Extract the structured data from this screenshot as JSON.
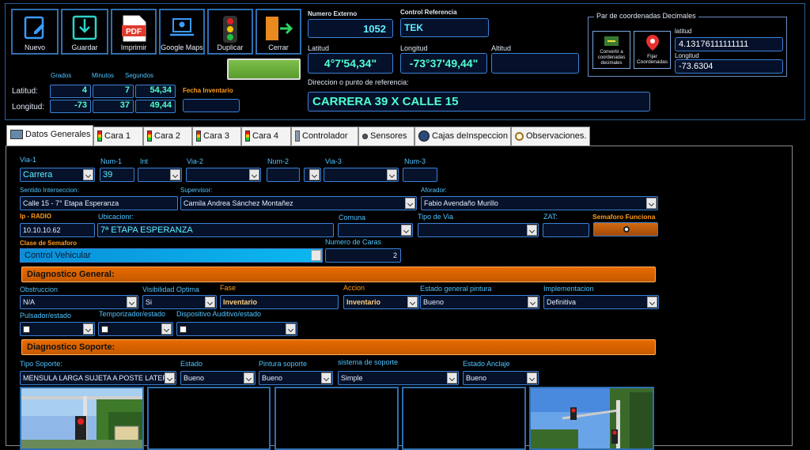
{
  "toolbar": {
    "nuevo": "Nuevo",
    "guardar": "Guardar",
    "imprimir": "Imprimir",
    "google_maps": "Google Maps",
    "duplicar": "Duplicar",
    "cerrar": "Cerrar"
  },
  "header": {
    "numero_externo_label": "Numero Externo",
    "numero_externo": "1052",
    "control_ref_label": "Control Referencia",
    "control_ref": "TEK",
    "latitud_label": "Latitud",
    "latitud": "4°7'54,34\"",
    "longitud_label": "Longitud",
    "longitud": "-73°37'49,44\"",
    "altitud_label": "Altitud",
    "altitud": "",
    "direccion_label": "Direccion o punto de referencia:",
    "direccion": "CARRERA 39 X CALLE 15"
  },
  "coords": {
    "title": "Par de coordenadas Decimales",
    "convert_label": "Convertir a coordenadas decimales",
    "fijar_label": "Fijar Coordenadas",
    "lat_label": "latitud",
    "lat": "4.13176111111111",
    "lon_label": "Longitud",
    "lon": "-73.6304"
  },
  "dms": {
    "grados": "Grados",
    "minutos": "Minutos",
    "segundos": "Segundos",
    "lat_label": "Latitud:",
    "lon_label": "Longitud:",
    "lat": [
      "4",
      "7",
      "54,34"
    ],
    "lon": [
      "-73",
      "37",
      "49,44"
    ],
    "fecha_label": "Fecha Inventario",
    "fecha": ""
  },
  "tabs": [
    "Datos Generales",
    "Cara 1",
    "Cara 2",
    "Cara 3",
    "Cara 4",
    "Controlador",
    "Sensores",
    "Cajas deInspeccion",
    "Observaciones."
  ],
  "form": {
    "via1_label": "Via-1",
    "via1": "Carrera",
    "num1_label": "Num-1",
    "num1": "39",
    "int_label": "Int",
    "via2_label": "Via-2",
    "num2_label": "Num-2",
    "via3_label": "Via-3",
    "num3_label": "Num-3",
    "sentido_label": "Sentido Interseccion:",
    "sentido": "Calle 15 - 7° Etapa Esperanza",
    "supervisor_label": "Supervisor:",
    "supervisor": "Camila Andrea Sánchez Montañez",
    "aforador_label": "Aforador:",
    "aforador": "Fabio Avendaño Murillo",
    "ip_label": "Ip - RADIO",
    "ip": "10.10.10.62",
    "ubic_label": "Ubicacionr:",
    "ubic": "7ª ETAPA ESPERANZA",
    "comuna_label": "Comuna",
    "tipo_via_label": "Tipo de Via",
    "zat_label": "ZAT:",
    "semaforo_label": "Semaforo Funciona",
    "clase_label": "Clase de Semaforo",
    "clase": "Control Vehicular",
    "caras_label": "Numero de Caras",
    "caras": "2",
    "diag_general": "Diagnostico General:",
    "obstruccion_label": "Obstruccion",
    "obstruccion": "N/A",
    "visib_label": "Visibilidad Optima",
    "visib": "Si",
    "fase_label": "Fase",
    "fase": "Inventario",
    "accion_label": "Accion",
    "accion": "Inventario",
    "pintura_label": "Estado general pintura",
    "pintura": "Bueno",
    "impl_label": "Implementacion",
    "impl": "Definitiva",
    "pulsador_label": "Pulsador/estado",
    "temp_label": "Temporizador/estado",
    "disp_label": "Dispositivo Auditivo/estado",
    "diag_soporte": "Diagnostico Soporte:",
    "tipo_sop_label": "Tipo Soporte:",
    "tipo_sop": "MENSULA LARGA SUJETA A POSTE LATERAL",
    "estado_label": "Estado",
    "estado": "Bueno",
    "pint_sop_label": "Pintura soporte",
    "pint_sop": "Bueno",
    "sist_label": "sistema de soporte",
    "sist": "Simple",
    "anclaje_label": "Estado Anclaje",
    "anclaje": "Bueno"
  }
}
